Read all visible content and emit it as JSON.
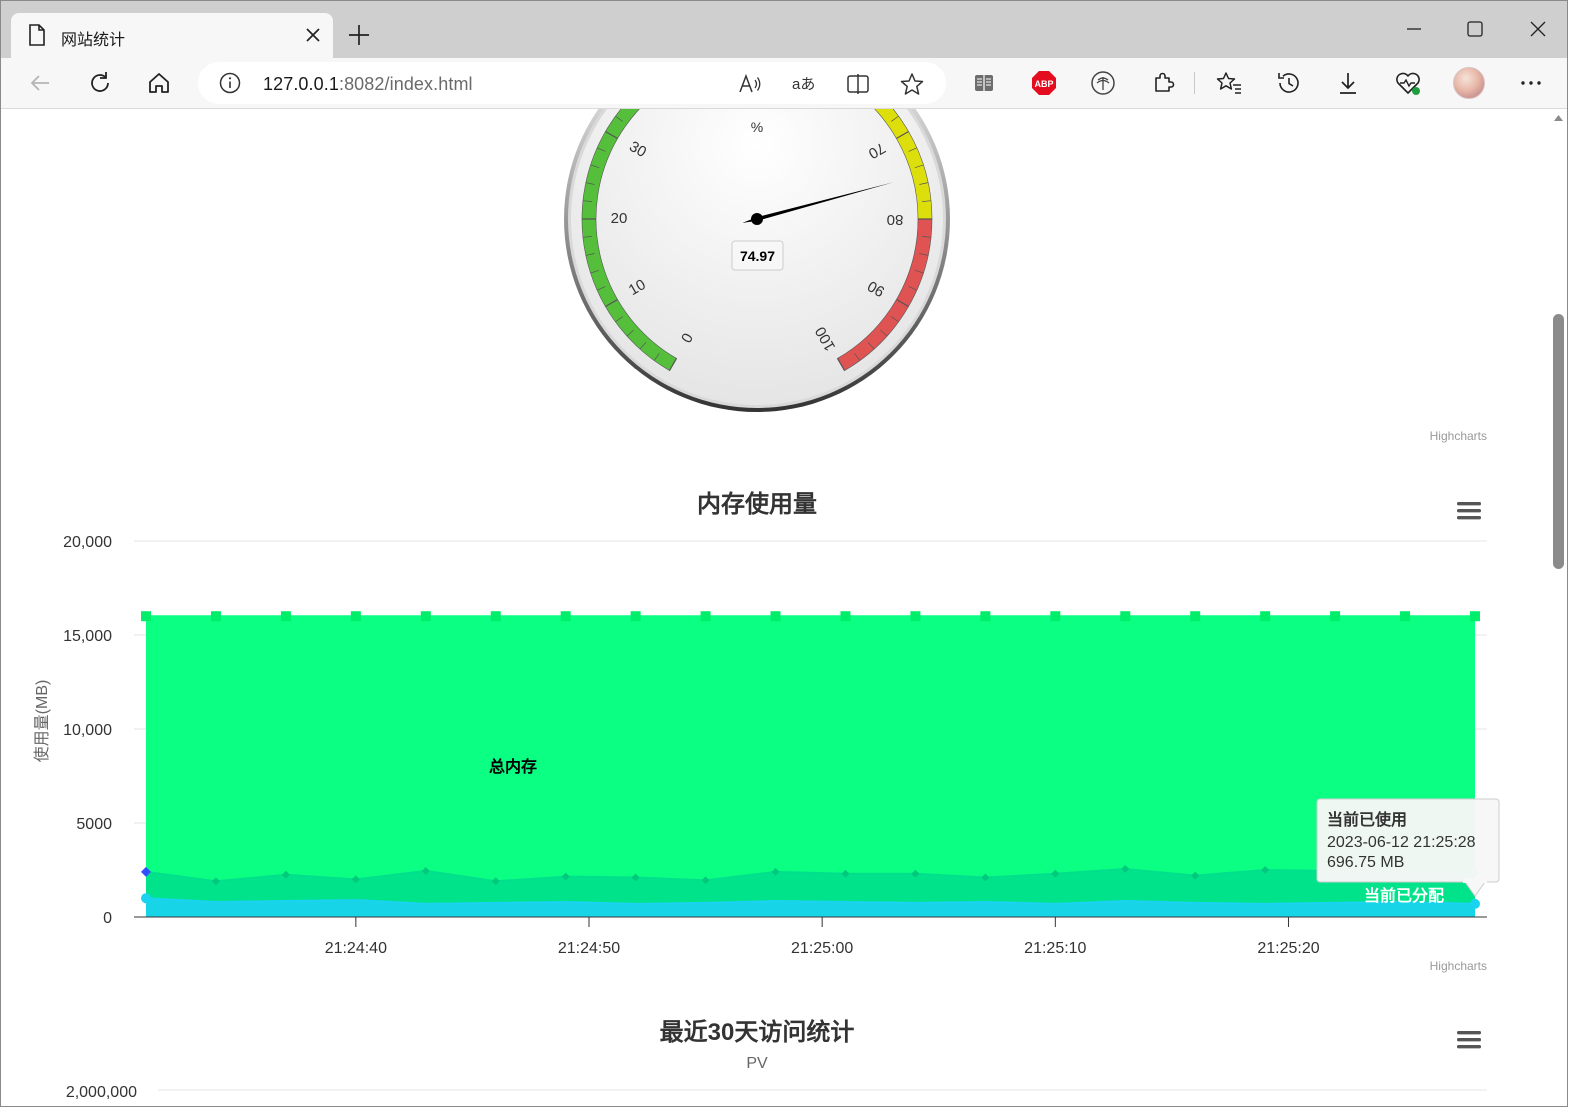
{
  "browser": {
    "tab_title": "网站统计",
    "url_host": "127.0.0.1",
    "url_rest": ":8082/index.html"
  },
  "gauge": {
    "unit": "%",
    "value": 74.97,
    "value_label": "74.97",
    "min": 0,
    "max": 100,
    "ticks": [
      "0",
      "10",
      "20",
      "30",
      "70",
      "80",
      "90",
      "100"
    ],
    "bands": [
      {
        "from": 0,
        "to": 60,
        "color": "#55bf3b"
      },
      {
        "from": 60,
        "to": 80,
        "color": "#dddf0d"
      },
      {
        "from": 80,
        "to": 100,
        "color": "#df5353"
      }
    ],
    "credit": "Highcharts"
  },
  "memory_chart": {
    "title": "内存使用量",
    "credit": "Highcharts",
    "chart_data": {
      "type": "area",
      "title": "内存使用量",
      "ylabel": "使用量(MB)",
      "ylim": [
        0,
        20000
      ],
      "y_ticks": [
        "20,000",
        "15,000",
        "10,000",
        "5000",
        "0"
      ],
      "y_tick_values": [
        20000,
        15000,
        10000,
        5000,
        0
      ],
      "x_ticks": [
        "21:24:40",
        "21:24:50",
        "21:25:00",
        "21:25:10",
        "21:25:20"
      ],
      "x": [
        "21:24:31",
        "21:24:34",
        "21:24:37",
        "21:24:40",
        "21:24:43",
        "21:24:46",
        "21:24:49",
        "21:24:52",
        "21:24:55",
        "21:24:58",
        "21:25:01",
        "21:25:04",
        "21:25:07",
        "21:25:10",
        "21:25:13",
        "21:25:16",
        "21:25:19",
        "21:25:22",
        "21:25:25",
        "21:25:28"
      ],
      "series": [
        {
          "name": "总内存",
          "color": "#0aff83",
          "marker": "square",
          "values": [
            16000,
            16000,
            16000,
            16000,
            16000,
            16000,
            16000,
            16000,
            16000,
            16000,
            16000,
            16000,
            16000,
            16000,
            16000,
            16000,
            16000,
            16000,
            16000,
            16000
          ]
        },
        {
          "name": "当前已分配",
          "color": "#00e08c",
          "marker": "diamond",
          "values": [
            2400,
            1900,
            2250,
            2000,
            2450,
            1900,
            2150,
            2100,
            1950,
            2400,
            2300,
            2300,
            2100,
            2300,
            2550,
            2200,
            2500,
            2450,
            2400,
            2350
          ]
        },
        {
          "name": "当前已使用",
          "color": "#19d3f0",
          "marker": "circle",
          "values": [
            1000,
            800,
            850,
            900,
            700,
            750,
            800,
            700,
            750,
            850,
            800,
            750,
            800,
            700,
            850,
            750,
            700,
            750,
            800,
            696.75
          ]
        }
      ]
    },
    "tooltip": {
      "series": "当前已使用",
      "time": "2023-06-12 21:25:28",
      "value": "696.75 MB"
    }
  },
  "visits_chart": {
    "title": "最近30天访问统计",
    "subtitle": "PV",
    "y_top_tick": "2,000,000"
  }
}
